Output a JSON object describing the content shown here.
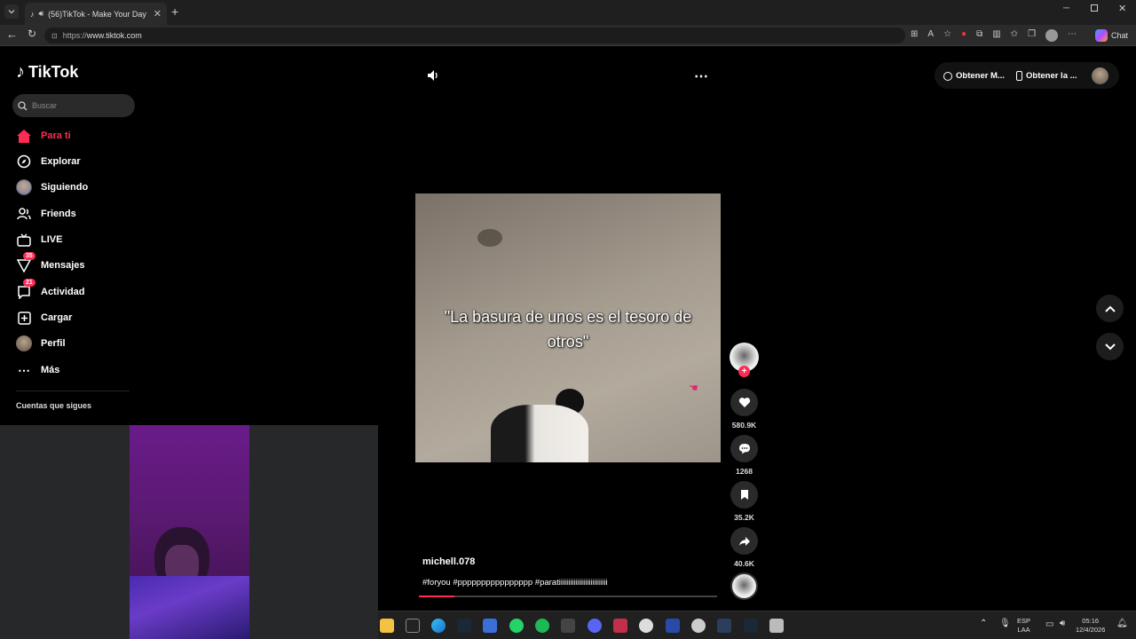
{
  "browser": {
    "tab_title": "(56)TikTok - Make Your Day",
    "url_proto": "https://",
    "url_host": "www.tiktok.com",
    "chat_label": "Chat"
  },
  "sidebar": {
    "logo_text": "TikTok",
    "search_placeholder": "Buscar",
    "items": [
      {
        "label": "Para ti",
        "icon": "home-icon"
      },
      {
        "label": "Explorar",
        "icon": "compass-icon"
      },
      {
        "label": "Siguiendo",
        "icon": "avatar"
      },
      {
        "label": "Friends",
        "icon": "friends-icon"
      },
      {
        "label": "LIVE",
        "icon": "live-icon"
      },
      {
        "label": "Mensajes",
        "icon": "send-icon",
        "badge": "35"
      },
      {
        "label": "Actividad",
        "icon": "inbox-icon",
        "badge": "21"
      },
      {
        "label": "Cargar",
        "icon": "plus-square-icon"
      },
      {
        "label": "Perfil",
        "icon": "avatar"
      },
      {
        "label": "Más",
        "icon": "more-icon"
      }
    ],
    "following_title": "Cuentas que sigues"
  },
  "topbar": {
    "get_coins": "Obtener M...",
    "get_app": "Obtener la ..."
  },
  "video": {
    "caption_line1": "\"La basura de unos es el tesoro de",
    "caption_line2": "otros\"",
    "username": "michell.078",
    "hashtags": "#foryou #pppppppppppppppp #paratiiiiiiiiiiiiiiiiiiiiiiiiii",
    "progress": 0.12
  },
  "actions": {
    "likes": "580.9K",
    "comments": "1268",
    "saves": "35.2K",
    "shares": "40.6K"
  },
  "taskbar": {
    "lang_top": "ESP",
    "lang_bottom": "LAA",
    "time": "05:16",
    "date": "12/4/2026"
  },
  "colors": {
    "accent": "#fe2c55",
    "background": "#000000"
  }
}
